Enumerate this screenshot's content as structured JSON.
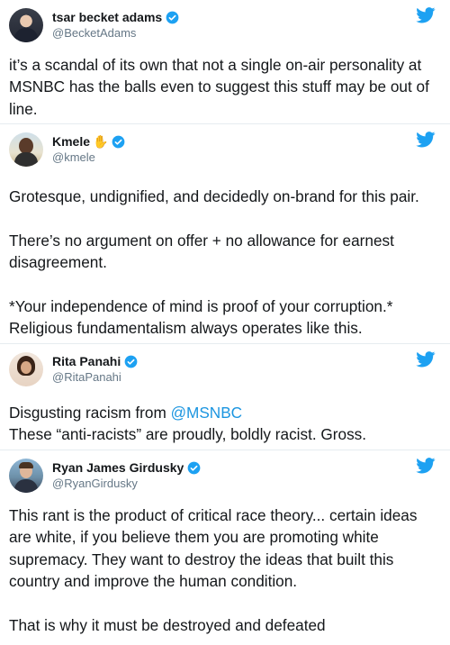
{
  "colors": {
    "accent": "#1da1f2",
    "link": "#1b95e0",
    "text": "#14171a",
    "handle": "#657786"
  },
  "tweets": [
    {
      "name": "tsar becket adams",
      "handle": "@BecketAdams",
      "verified": true,
      "body": "it’s a scandal of its own that not a single on-air personality at MSNBC has the balls even to suggest this stuff may be out of line."
    },
    {
      "name": "Kmele",
      "name_emoji": "✋",
      "handle": "@kmele",
      "verified": true,
      "body": "Grotesque, undignified, and decidedly on-brand for this pair.\n\nThere’s no argument on offer + no allowance for earnest disagreement.\n\n*Your independence of mind is proof of your corruption.* Religious fundamentalism always operates like this."
    },
    {
      "name": "Rita Panahi",
      "handle": "@RitaPanahi",
      "verified": true,
      "body_prefix": "Disgusting racism from ",
      "body_mention": "@MSNBC",
      "body_suffix": "\nThese “anti-racists” are proudly, boldly racist. Gross."
    },
    {
      "name": "Ryan James Girdusky",
      "handle": "@RyanGirdusky",
      "verified": true,
      "body": "This rant is the product of critical race theory... certain ideas are white, if you believe them you are promoting white supremacy. They want to destroy the ideas that built this country and improve the human condition.\n\nThat is why it must be destroyed and defeated"
    }
  ]
}
